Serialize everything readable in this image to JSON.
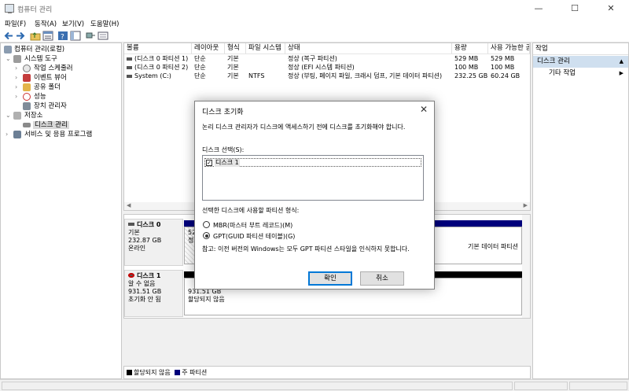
{
  "window": {
    "title": "컴퓨터 관리",
    "controls": {
      "minimize": "—",
      "maximize": "☐",
      "close": "✕"
    }
  },
  "menu": [
    "파일(F)",
    "동작(A)",
    "보기(V)",
    "도움말(H)"
  ],
  "toolbar": [
    "back-arrow-icon",
    "forward-arrow-icon",
    "folder-up-icon",
    "properties-list-icon",
    "help-icon",
    "show-hide-tree-icon",
    "connect-icon",
    "export-list-icon"
  ],
  "tree": {
    "root": "컴퓨터 관리(로컬)",
    "system_tools": "시스템 도구",
    "task_scheduler": "작업 스케줄러",
    "event_viewer": "이벤트 뷰어",
    "shared_folders": "공유 폴더",
    "performance": "성능",
    "device_manager": "장치 관리자",
    "storage": "저장소",
    "disk_management": "디스크 관리",
    "services": "서비스 및 응용 프로그램"
  },
  "volume_list": {
    "columns": [
      "볼륨",
      "레이아웃",
      "형식",
      "파일 시스템",
      "상태",
      "용량",
      "사용 가능한 공"
    ],
    "rows": [
      [
        "(디스크 0 파티션 1)",
        "단순",
        "기본",
        "",
        "정상 (복구 파티션)",
        "529 MB",
        "529 MB"
      ],
      [
        "(디스크 0 파티션 2)",
        "단순",
        "기본",
        "",
        "정상 (EFI 시스템 파티션)",
        "100 MB",
        "100 MB"
      ],
      [
        "System (C:)",
        "단순",
        "기본",
        "NTFS",
        "정상 (부팅, 페이지 파일, 크래시 덤프, 기본 데이터 파티션)",
        "232.25 GB",
        "60.24 GB"
      ]
    ]
  },
  "disk_view": {
    "disk0": {
      "name": "디스크 0",
      "type": "기본",
      "size": "232.87 GB",
      "status": "온라인",
      "part_size_partial": "52",
      "part_status_partial": "정",
      "right_part_text": "기본 데이터 파티션"
    },
    "disk1": {
      "name": "디스크 1",
      "type": "알 수 없음",
      "size": "931.51 GB",
      "status": "초기화 안 됨",
      "part_size": "931.51 GB",
      "part_status": "할당되지 않음"
    }
  },
  "legend": {
    "unallocated": "할당되지 않음",
    "primary": "주 파티션",
    "colors": {
      "unallocated": "#000000",
      "primary": "#00007b"
    }
  },
  "actions": {
    "header": "작업",
    "section": "디스크 관리",
    "more": "기타 작업"
  },
  "dialog": {
    "title": "디스크 초기화",
    "description": "논리 디스크 관리자가 디스크에 액세스하기 전에 디스크를 초기화해야 합니다.",
    "select_label": "디스크 선택(S):",
    "disks": [
      {
        "label": "디스크 1",
        "checked": true
      }
    ],
    "style_label": "선택한 디스크에 사용할 파티션 형식:",
    "options": [
      {
        "label": "MBR(마스터 부트 레코드)(M)",
        "selected": false
      },
      {
        "label": "GPT(GUID 파티션 테이블)(G)",
        "selected": true
      }
    ],
    "note": "참고: 이전 버전의 Windows는 모두 GPT 파티션 스타일을 인식하지 못합니다.",
    "ok": "확인",
    "cancel": "취소"
  }
}
